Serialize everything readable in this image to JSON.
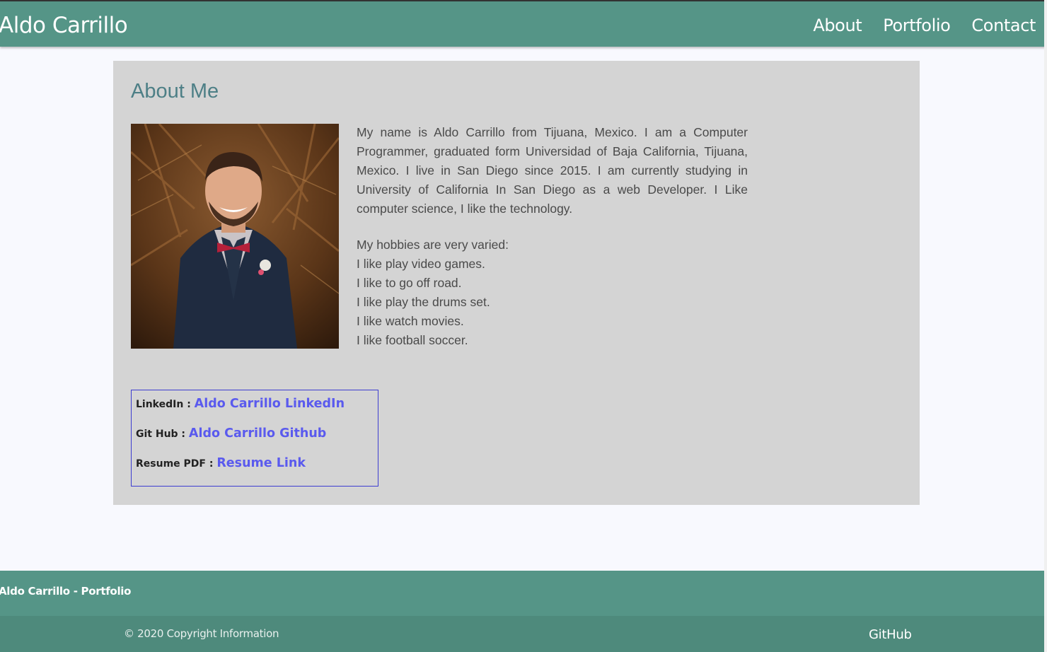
{
  "nav": {
    "brand": "Aldo Carrillo",
    "links": [
      "About",
      "Portfolio",
      "Contact"
    ]
  },
  "about": {
    "title": "About Me",
    "photo_icon": "portrait-photo",
    "bio": "My name is Aldo Carrillo from Tijuana, Mexico. I am a Computer Programmer, graduated form Universidad of Baja California, Tijuana, Mexico. I live in San Diego since 2015. I am currently studying in University of California In San Diego as a web Developer. I Like computer science, I like the technology.",
    "hobbies_intro": "My hobbies are very varied:",
    "hobbies": [
      "I like play video games.",
      "I like to go off road.",
      "I like play the drums set.",
      "I like watch movies.",
      "I like football soccer."
    ]
  },
  "links": [
    {
      "label": "LinkedIn : ",
      "text": "Aldo Carrillo LinkedIn"
    },
    {
      "label": "Git Hub : ",
      "text": "Aldo Carrillo Github"
    },
    {
      "label": "Resume PDF : ",
      "text": "Resume Link"
    }
  ],
  "footer": {
    "title": "Aldo Carrillo - Portfolio",
    "copyright": "© 2020 Copyright Information",
    "github": "GitHub"
  },
  "colors": {
    "navbar": "#559587",
    "card": "#d4d4d4",
    "heading": "#4d7f86",
    "link": "#5a5aee",
    "footer_bottom": "#4e8a7c"
  }
}
